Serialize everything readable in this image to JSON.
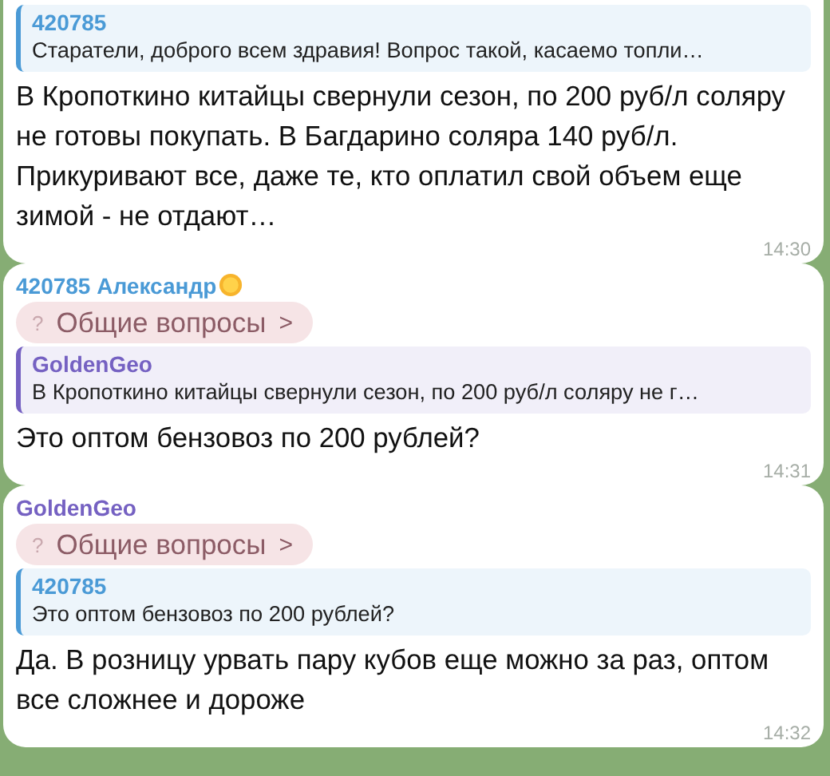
{
  "messages": [
    {
      "reply": {
        "author": "420785",
        "color": "#4a9ad6",
        "text": "Старатели, доброго всем здравия! Вопрос такой, касаемо топли…"
      },
      "text": "В Кропоткино китайцы свернули сезон, по 200 руб/л соляру не готовы покупать. В Багдарино соляра 140 руб/л. Прикуривают все, даже те, кто оплатил свой объем еще зимой - не отдают…",
      "time": "14:30"
    },
    {
      "sender": {
        "name": "420785 Александр",
        "color": "#4a9ad6",
        "emoji": true
      },
      "topic": {
        "icon": "?",
        "label": "Общие вопросы",
        "arrow": ">"
      },
      "reply": {
        "author": "GoldenGeo",
        "color": "#7561c2",
        "text": "В Кропоткино китайцы свернули сезон, по 200 руб/л соляру не г…"
      },
      "text": "Это оптом бензовоз по 200 рублей?",
      "time": "14:31"
    },
    {
      "sender": {
        "name": "GoldenGeo",
        "color": "#7561c2"
      },
      "topic": {
        "icon": "?",
        "label": "Общие вопросы",
        "arrow": ">"
      },
      "reply": {
        "author": "420785",
        "color": "#4a9ad6",
        "text": "Это оптом бензовоз по 200 рублей?"
      },
      "text": "Да. В розницу урвать пару кубов еще можно за раз, оптом все сложнее и дороже",
      "time": "14:32"
    }
  ]
}
